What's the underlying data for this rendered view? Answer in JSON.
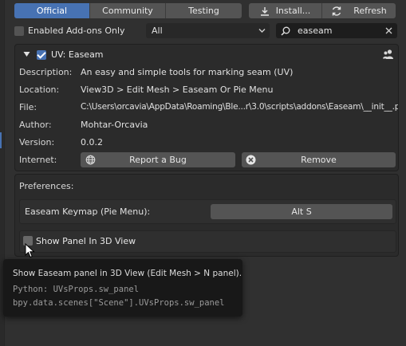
{
  "tabs": {
    "official": "Official",
    "community": "Community",
    "testing": "Testing",
    "active": "community"
  },
  "toolbar": {
    "install_label": "Install...",
    "refresh_label": "Refresh"
  },
  "filter": {
    "enabled_only_label": "Enabled Add-ons Only",
    "enabled_only_checked": false,
    "category_value": "All",
    "search_value": "easeam"
  },
  "addon": {
    "name": "UV: Easeam",
    "enabled": true,
    "expanded": true,
    "fields": {
      "description_label": "Description:",
      "description_value": "An easy and simple tools for marking seam (UV)",
      "location_label": "Location:",
      "location_value": "View3D > Edit Mesh > Easeam Or Pie Menu",
      "file_label": "File:",
      "file_value": "C:\\Users\\orcavia\\AppData\\Roaming\\Ble...r\\3.0\\scripts\\addons\\Easeam\\__init__.py",
      "author_label": "Author:",
      "author_value": "Mohtar-Orcavia",
      "version_label": "Version:",
      "version_value": "0.0.2",
      "internet_label": "Internet:"
    },
    "report_bug_label": "Report a Bug",
    "remove_label": "Remove"
  },
  "preferences": {
    "title": "Preferences:",
    "keymap_label": "Easeam Keymap (Pie Menu):",
    "keymap_value": "Alt S",
    "show_panel_label": "Show Panel In 3D View",
    "show_panel_checked": false
  },
  "tooltip": {
    "description": "Show Easeam panel in 3D View (Edit Mesh > N panel).",
    "python_line": "Python: UVsProps.sw_panel",
    "data_path": "bpy.data.scenes[\"Scene\"].UVsProps.sw_panel"
  },
  "colors": {
    "accent": "#4772b3",
    "background": "#303030",
    "panel": "#2b2b2b",
    "button": "#545454"
  }
}
